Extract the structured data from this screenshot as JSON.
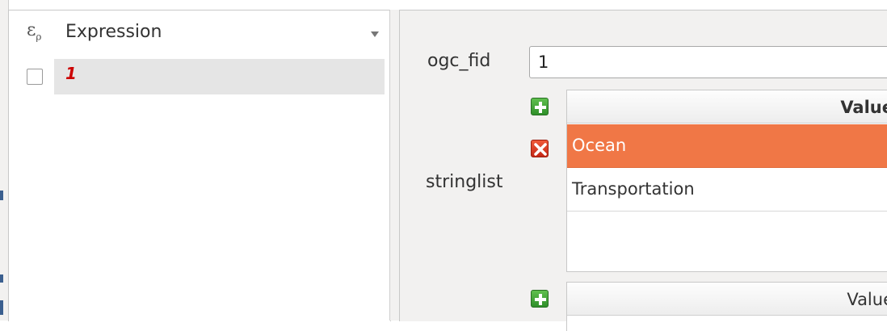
{
  "list": {
    "expression_icon": "epsilon-expression-icon",
    "expression_label": "Expression",
    "dropdown_icon": "dropdown-arrow-icon",
    "rows": [
      {
        "value": "1",
        "checked": false
      }
    ]
  },
  "form": {
    "fields": {
      "ogc_fid": {
        "label": "ogc_fid",
        "value": "1"
      },
      "stringlist": {
        "label": "stringlist",
        "header": "Value",
        "values": [
          "Ocean",
          "Transportation"
        ],
        "selected_index": 0
      },
      "second_list": {
        "header": "Value"
      }
    },
    "icons": {
      "add": "plus-icon",
      "remove": "close-icon"
    }
  },
  "colors": {
    "selection": "#f07746",
    "row_highlight": "#e5e5e5",
    "row_text": "#cc0000",
    "add_button": "#3a9a33",
    "remove_button": "#d83a20"
  }
}
